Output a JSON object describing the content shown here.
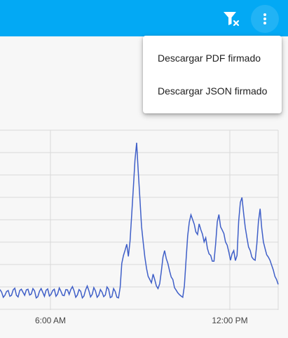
{
  "appbar": {
    "background": "#03a9f4",
    "icons": [
      "filter-clear-icon",
      "more-vert-icon"
    ]
  },
  "menu": {
    "items": [
      {
        "label": "Descargar PDF firmado"
      },
      {
        "label": "Descargar JSON firmado"
      }
    ]
  },
  "chart_data": {
    "type": "line",
    "title": "",
    "xlabel": "",
    "ylabel": "",
    "x_ticks": [
      "6:00 AM",
      "12:00 PM"
    ],
    "grid": true,
    "legend": "none",
    "line_color": "#3f5fc8",
    "series": [
      {
        "values": [
          0.44,
          0.36,
          0.2,
          0.26,
          0.38,
          0.41,
          0.23,
          0.26,
          0.43,
          0.48,
          0.26,
          0.21,
          0.41,
          0.45,
          0.35,
          0.26,
          0.43,
          0.45,
          0.27,
          0.3,
          0.47,
          0.4,
          0.18,
          0.22,
          0.39,
          0.47,
          0.35,
          0.23,
          0.42,
          0.46,
          0.24,
          0.29,
          0.41,
          0.45,
          0.23,
          0.3,
          0.49,
          0.39,
          0.26,
          0.25,
          0.44,
          0.43,
          0.29,
          0.44,
          0.53,
          0.4,
          0.2,
          0.27,
          0.44,
          0.39,
          0.18,
          0.24,
          0.43,
          0.55,
          0.4,
          0.21,
          0.29,
          0.5,
          0.4,
          0.2,
          0.26,
          0.44,
          0.36,
          0.22,
          0.27,
          0.52,
          0.45,
          0.19,
          0.22,
          0.47,
          0.38,
          0.2,
          0.18,
          0.51,
          1.25,
          1.5,
          1.66,
          1.85,
          1.47,
          1.95,
          2.75,
          3.6,
          4.45,
          5.0,
          4.1,
          3.25,
          2.4,
          1.9,
          1.45,
          1.1,
          0.85,
          0.75,
          0.65,
          0.92,
          0.75,
          0.55,
          0.47,
          0.62,
          1.0,
          1.45,
          1.65,
          1.4,
          1.25,
          1.02,
          0.83,
          0.75,
          0.5,
          0.42,
          0.34,
          0.28,
          0.24,
          0.2,
          0.55,
          1.32,
          2.1,
          2.53,
          2.76,
          2.62,
          2.47,
          2.23,
          2.15,
          2.48,
          2.3,
          2.16,
          1.92,
          2.05,
          1.72,
          1.55,
          1.5,
          1.32,
          1.32,
          1.85,
          2.55,
          2.77,
          2.39,
          2.29,
          2.18,
          1.92,
          1.82,
          1.61,
          1.35,
          1.55,
          1.65,
          1.34,
          1.5,
          2.56,
          3.15,
          3.3,
          2.8,
          2.37,
          2.05,
          1.76,
          1.65,
          1.45,
          1.38,
          1.35,
          1.85,
          2.55,
          2.95,
          2.35,
          1.92,
          1.72,
          1.52,
          1.45,
          1.35,
          1.2,
          1.05,
          0.85,
          0.75,
          0.6
        ]
      }
    ]
  }
}
